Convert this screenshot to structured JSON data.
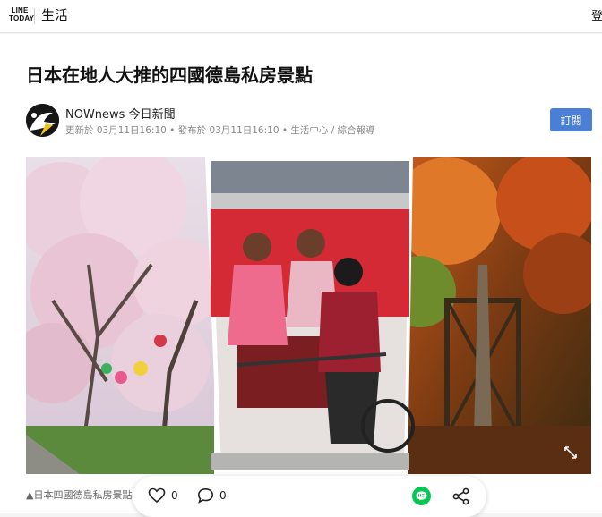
{
  "header": {
    "logo_line1": "LINE",
    "logo_line2": "TODAY",
    "section": "生活",
    "login_label": "登"
  },
  "article": {
    "title": "日本在地人大推的四國德島私房景點",
    "publisher": "NOWnews 今日新聞",
    "meta": "更新於 03月11日16:10 • 發布於 03月11日16:10 • 生活中心 / 綜合報導",
    "subscribe_label": "訂閱",
    "caption": "▲日本四國德島私房景點"
  },
  "actions": {
    "like_count": "0",
    "comment_count": "0"
  },
  "colors": {
    "accent": "#4a7fd3",
    "line_green": "#06c755"
  },
  "icons": [
    "heart-icon",
    "comment-icon",
    "line-share-icon",
    "share-icon",
    "expand-icon"
  ]
}
